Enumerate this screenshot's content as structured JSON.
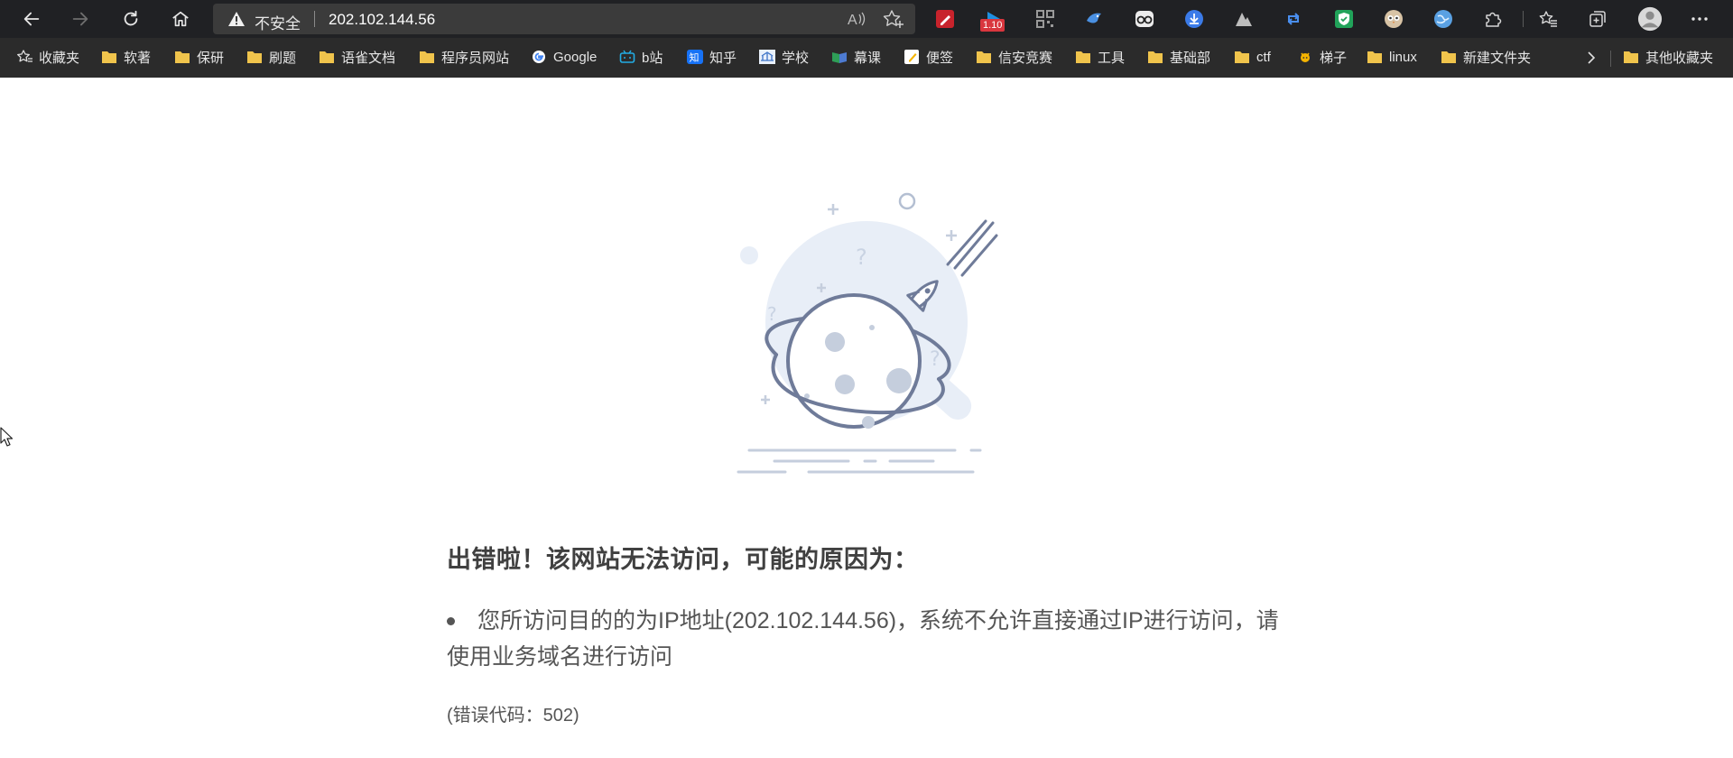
{
  "browser": {
    "security_label": "不安全",
    "url": "202.102.144.56",
    "extension_badge": "1.10",
    "extensions": [
      "pen-icon",
      "video-ext-icon",
      "qr-code-icon",
      "bird-icon",
      "glasses-icon",
      "download-icon",
      "mountain-icon",
      "retweet-icon",
      "shield-check-icon",
      "owl-icon",
      "globe-icon",
      "puzzle-icon"
    ]
  },
  "bookmarks": [
    {
      "label": "收藏夹",
      "icon": "favorites-star-icon"
    },
    {
      "label": "软著",
      "icon": "folder-icon"
    },
    {
      "label": "保研",
      "icon": "folder-icon"
    },
    {
      "label": "刷题",
      "icon": "folder-icon"
    },
    {
      "label": "语雀文档",
      "icon": "folder-icon"
    },
    {
      "label": "程序员网站",
      "icon": "folder-icon"
    },
    {
      "label": "Google",
      "icon": "google-icon"
    },
    {
      "label": "b站",
      "icon": "bilibili-icon"
    },
    {
      "label": "知乎",
      "icon": "zhihu-icon"
    },
    {
      "label": "学校",
      "icon": "school-icon"
    },
    {
      "label": "幕课",
      "icon": "mooc-icon"
    },
    {
      "label": "便签",
      "icon": "note-icon"
    },
    {
      "label": "信安竞赛",
      "icon": "folder-icon"
    },
    {
      "label": "工具",
      "icon": "folder-icon"
    },
    {
      "label": "基础部",
      "icon": "folder-icon"
    },
    {
      "label": "ctf",
      "icon": "folder-icon"
    },
    {
      "label": "梯子",
      "icon": "ladder-icon"
    },
    {
      "label": "linux",
      "icon": "folder-icon"
    },
    {
      "label": "新建文件夹",
      "icon": "folder-icon"
    },
    {
      "label": "其他收藏夹",
      "icon": "folder-icon"
    }
  ],
  "page": {
    "title": "出错啦！该网站无法访问，可能的原因为：",
    "reason_line1": "您所访问目的的为IP地址(202.102.144.56)，系统不允许直接通过IP进行访问，请",
    "reason_line2": "使用业务域名进行访问",
    "error_code_prefix": "(错误代码：",
    "error_code_value": "502)"
  },
  "colors": {
    "chrome_dark": "#202124",
    "bookmarks_bar": "#2b2b2b",
    "folder_yellow": "#f0c44c",
    "illustration_stroke": "#6f7b99",
    "illustration_fill": "#e8eef7",
    "text_dark": "#404040",
    "text_body": "#555555"
  }
}
